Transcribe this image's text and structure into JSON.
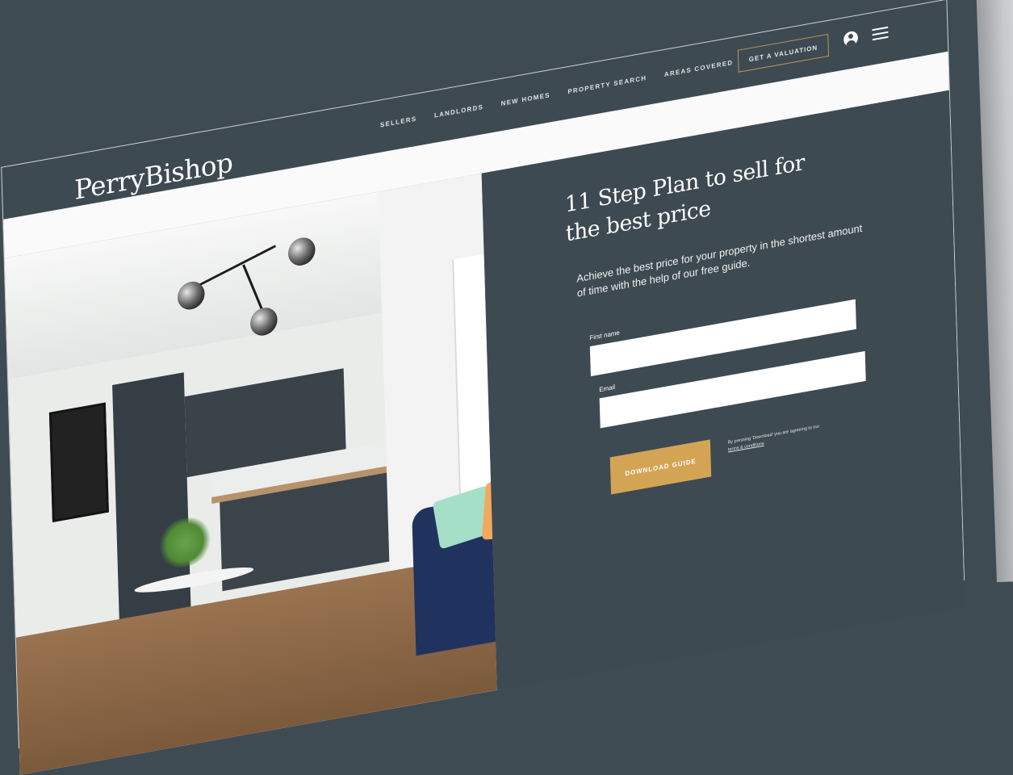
{
  "brand": {
    "logo": "PerryBishop"
  },
  "nav": {
    "links": [
      "SELLERS",
      "LANDLORDS",
      "NEW HOMES",
      "PROPERTY SEARCH",
      "AREAS COVERED"
    ],
    "cta": "GET A VALUATION"
  },
  "icons": {
    "account": "account-icon",
    "menu": "menu-icon"
  },
  "hero": {
    "headline_line1": "11 Step Plan to sell for",
    "headline_line2": "the best price",
    "subtext": "Achieve the best price for your property in the shortest amount of time with the help of our free guide."
  },
  "form": {
    "first_name_label": "First name",
    "first_name_value": "",
    "email_label": "Email",
    "email_value": "",
    "submit_label": "DOWNLOAD GUIDE",
    "terms_text": "By pressing 'Download' you are agreeing to our",
    "terms_link": "terms & conditions"
  },
  "colors": {
    "background": "#3f4b53",
    "panel": "#3e4a52",
    "accent": "#d4a455",
    "cta_border": "#b8965a",
    "strip": "#fafafa"
  }
}
